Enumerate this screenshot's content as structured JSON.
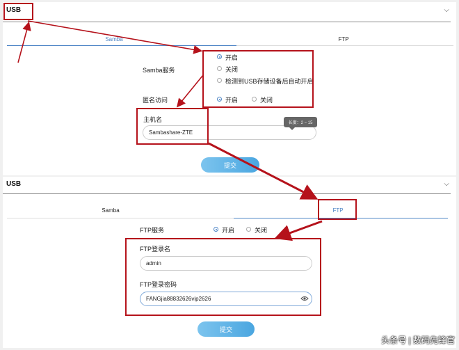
{
  "panel1": {
    "title": "USB",
    "tabs": [
      {
        "label": "Samba"
      },
      {
        "label": "FTP"
      }
    ],
    "samba_service_label": "Samba服务",
    "samba_options": [
      "开启",
      "关闭",
      "检测到USB存储设备后自动开启"
    ],
    "anon_label": "匿名访问",
    "anon_options": [
      "开启",
      "关闭"
    ],
    "hostname_label": "主机名",
    "hostname_value": "Sambashare-ZTE",
    "hostname_hint": "长度：2 ~ 15",
    "submit_label": "提交"
  },
  "panel2": {
    "title": "USB",
    "tabs": [
      {
        "label": "Samba"
      },
      {
        "label": "FTP"
      }
    ],
    "ftp_service_label": "FTP服务",
    "ftp_options": [
      "开启",
      "关闭"
    ],
    "login_label": "FTP登录名",
    "login_value": "admin",
    "password_label": "FTP登录密码",
    "password_value": "FANGjia88832626vip2626",
    "submit_label": "提交"
  },
  "icons": {
    "collapse": "chevron-down-icon",
    "password_toggle": "eye-icon"
  },
  "colors": {
    "accent": "#4f86c6",
    "annotation": "#b5121b",
    "button": "#5ab0e6"
  },
  "watermark": "头条号 | 数码先锋官"
}
